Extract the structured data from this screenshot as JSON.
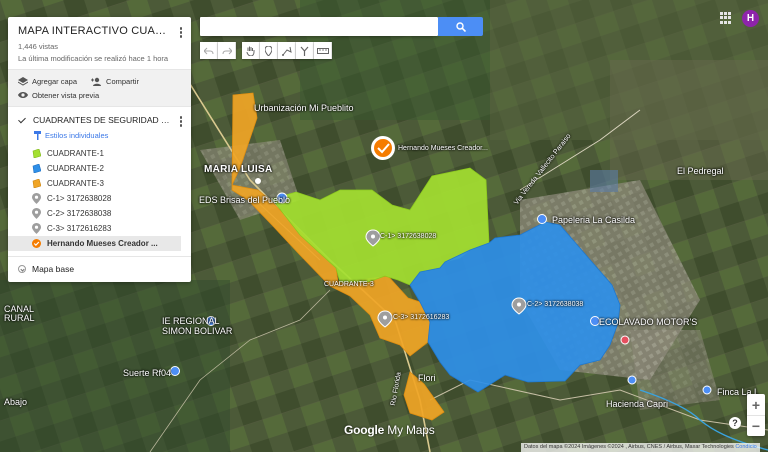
{
  "panel": {
    "title": "MAPA INTERACTIVO CUADRANT...",
    "views": "1,446 vistas",
    "modified": "La última modificación se realizó hace 1 hora",
    "add_layer": "Agregar capa",
    "share": "Compartir",
    "preview": "Obtener vista previa",
    "layer_name": "CUADRANTES DE SEGURIDAD FLO...",
    "styles": "Estilos individuales",
    "items": [
      {
        "label": "CUADRANTE-1",
        "kind": "polygon",
        "color": "#a4e031"
      },
      {
        "label": "CUADRANTE-2",
        "kind": "polygon",
        "color": "#2e8fe8"
      },
      {
        "label": "CUADRANTE-3",
        "kind": "polygon",
        "color": "#f0a526"
      },
      {
        "label": "C-1> 3172638028",
        "kind": "pin",
        "color": "#9e9e9e"
      },
      {
        "label": "C-2> 3172638038",
        "kind": "pin",
        "color": "#9e9e9e"
      },
      {
        "label": "C-3> 3172616283",
        "kind": "pin",
        "color": "#9e9e9e"
      },
      {
        "label": "Hernando Mueses Creador ...",
        "kind": "pin",
        "color": "#f57c00",
        "selected": true
      }
    ],
    "base_map": "Mapa base"
  },
  "search": {
    "placeholder": "",
    "value": ""
  },
  "user": {
    "initial": "H",
    "color": "#8e24aa"
  },
  "map": {
    "quadrant_colors": {
      "c1": "#a4e031",
      "c2": "#2e8fe8",
      "c3": "#f0a526"
    },
    "labels": {
      "urbanizacion": "Urbanización Mi Pueblito",
      "maria_luisa": "MARIA LUISA",
      "eds": "EDS Brisas del Pueblo",
      "el_pedregal": "El Pedregal",
      "papeleria": "Papeleria La Casilda",
      "vereda": "Via Vereda Vallecito Paraiso",
      "ecolavado": "ECOLAVADO MOTOR'S",
      "regional": "IE REGIONAL",
      "simon": "SIMON BOLIVAR",
      "suerte": "Suerte Rf04",
      "canal": "CANAL",
      "rural": "RURAL",
      "abajo": "Abajo",
      "finca": "Finca La L",
      "hacienda": "Hacienda Capri",
      "rio": "Rio Florida",
      "hernando": "Hernando Mueses Creador...",
      "c1_pin": "C-1> 3172638028",
      "c2_pin": "C-2> 3172638038",
      "c3_pin": "C-3> 3172616283",
      "c3_area": "CUADRANTE-3",
      "flor": "Flori"
    }
  },
  "logo": {
    "google": "Google",
    "mymaps": "My Maps"
  },
  "attribution": {
    "text": "Datos del mapa ©2024 Imágenes ©2024 , Airbus, CNES / Airbus, Maxar Technologies",
    "link": "Condicio"
  }
}
